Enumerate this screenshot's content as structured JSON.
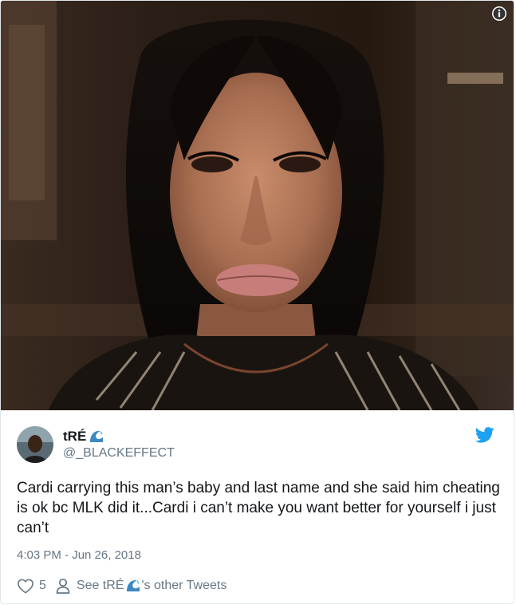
{
  "photo": {
    "alt": "",
    "info_icon": "info-icon"
  },
  "author": {
    "display_name": "tRÉ",
    "name_emoji": "water-wave-emoji",
    "handle": "@_BLACKEFFECT",
    "avatar": "avatar-photo"
  },
  "brand": {
    "icon": "twitter-bird-icon",
    "color": "#1da1f2"
  },
  "tweet": {
    "text": "Cardi carrying this man’s baby and last name and she said him cheating is ok bc MLK did it...Cardi i can’t make you want better for yourself i just can’t",
    "timestamp": "4:03 PM - Jun 26, 2018"
  },
  "actions": {
    "like_icon": "heart-icon",
    "like_count": "5",
    "person_icon": "person-icon",
    "other_prefix": "See tRÉ",
    "other_suffix": "'s other Tweets"
  },
  "colors": {
    "text": "#14171a",
    "secondary": "#657786",
    "border": "#e1e8ed"
  }
}
